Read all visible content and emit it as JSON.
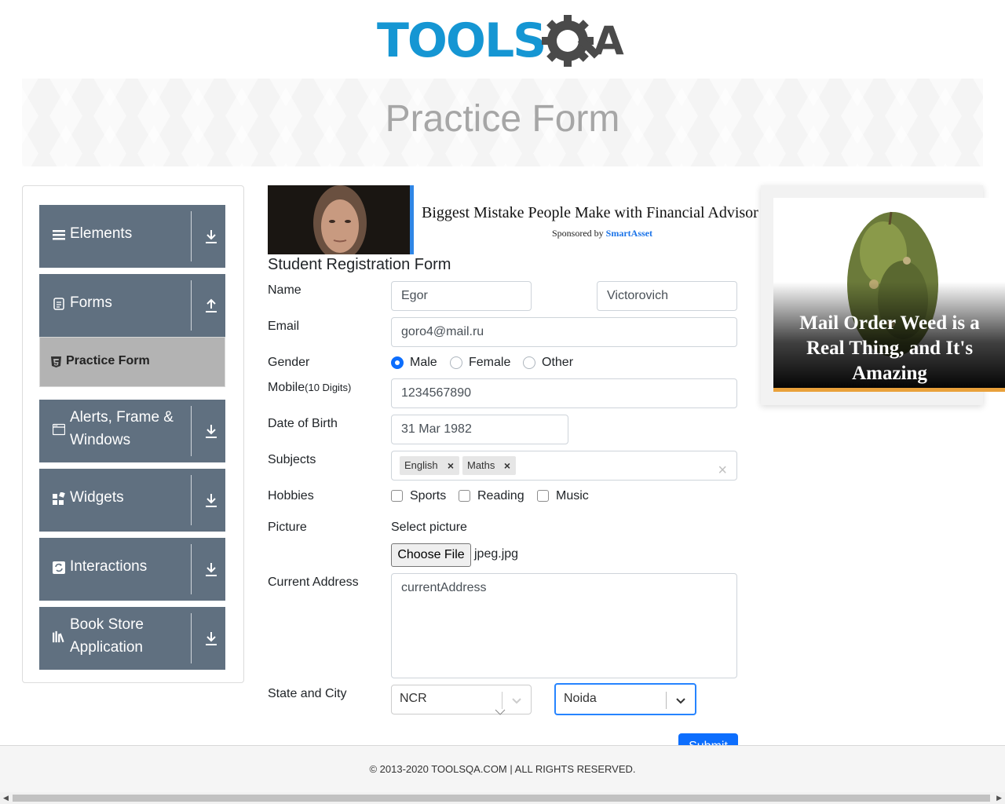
{
  "header": {
    "logo_text": "TOOLSQA"
  },
  "banner": {
    "title": "Practice Form"
  },
  "sidebar": {
    "groups": [
      {
        "label": "Elements",
        "icon": "menu-icon",
        "arrow": "download-arrow-icon"
      },
      {
        "label": "Forms",
        "icon": "document-icon",
        "arrow": "upload-arrow-icon"
      },
      {
        "label": "Alerts, Frame & Windows",
        "icon": "window-icon",
        "arrow": "download-arrow-icon"
      },
      {
        "label": "Widgets",
        "icon": "widgets-icon",
        "arrow": "download-arrow-icon"
      },
      {
        "label": "Interactions",
        "icon": "interactions-icon",
        "arrow": "download-arrow-icon"
      },
      {
        "label": "Book Store Application",
        "icon": "books-icon",
        "arrow": "download-arrow-icon"
      }
    ],
    "active_item": {
      "label": "Practice Form",
      "icon": "html-icon"
    }
  },
  "ad_top": {
    "headline": "Biggest Mistake People Make with Financial Advisor",
    "sponsored_by": "Sponsored by",
    "sponsor": "SmartAsset"
  },
  "ad_side": {
    "caption": "Mail Order Weed is a Real Thing, and It's Amazing"
  },
  "form": {
    "title": "Student Registration Form",
    "name_label": "Name",
    "first_name": "Egor",
    "last_name": "Victorovich",
    "email_label": "Email",
    "email": "goro4@mail.ru",
    "gender_label": "Gender",
    "genders": [
      "Male",
      "Female",
      "Other"
    ],
    "gender_selected": "Male",
    "mobile_label": "Mobile",
    "mobile_hint": "(10 Digits)",
    "mobile": "1234567890",
    "dob_label": "Date of Birth",
    "dob": "31 Mar 1982",
    "subjects_label": "Subjects",
    "subjects": [
      "English",
      "Maths"
    ],
    "hobbies_label": "Hobbies",
    "hobbies": [
      "Sports",
      "Reading",
      "Music"
    ],
    "picture_label": "Picture",
    "select_picture": "Select picture",
    "choose_file": "Choose File",
    "file_name": "jpeg.jpg",
    "address_label": "Current Address",
    "address": "currentAddress",
    "state_city_label": "State and City",
    "state": "NCR",
    "city": "Noida",
    "submit": "Submit"
  },
  "footer": {
    "text": "© 2013-2020 TOOLSQA.COM | ALL RIGHTS RESERVED."
  }
}
